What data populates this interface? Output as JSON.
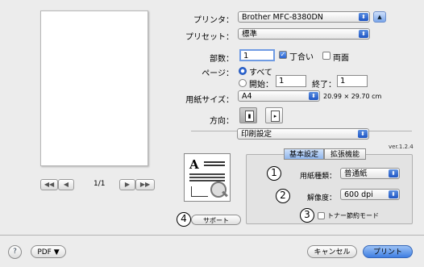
{
  "printer": {
    "label": "プリンタ：",
    "value": "Brother MFC-8380DN"
  },
  "preset": {
    "label": "プリセット：",
    "value": "標準"
  },
  "copies": {
    "label": "部数：",
    "value": "1",
    "collated_label": "丁合い",
    "duplex_label": "両面"
  },
  "pages": {
    "label": "ページ：",
    "all_label": "すべて",
    "from_label": "開始：",
    "from_value": "1",
    "to_label": "終了：",
    "to_value": "1"
  },
  "paper_size": {
    "label": "用紙サイズ：",
    "value": "A4",
    "dimensions": "20.99 × 29.70 cm"
  },
  "orientation": {
    "label": "方向："
  },
  "panel": {
    "value": "印刷設定",
    "version": "ver.1.2.4"
  },
  "tabs": {
    "basic": "基本設定",
    "advanced": "拡張機能"
  },
  "media_type": {
    "label": "用紙種類：",
    "value": "普通紙"
  },
  "resolution": {
    "label": "解像度：",
    "value": "600 dpi"
  },
  "toner_save": {
    "label": "トナー節約モード"
  },
  "support_button": "サポート",
  "page_nav": {
    "indicator": "1/1",
    "first": "◀◀",
    "prev": "◀",
    "next": "▶",
    "last": "▶▶"
  },
  "callouts": {
    "n1": "1",
    "n2": "2",
    "n3": "3",
    "n4": "4"
  },
  "footer": {
    "help": "?",
    "pdf": "PDF ▼",
    "cancel": "キャンセル",
    "print": "プリント"
  },
  "colors": {
    "accent": "#2a63d0",
    "panel_bg": "#e3e3e3"
  }
}
